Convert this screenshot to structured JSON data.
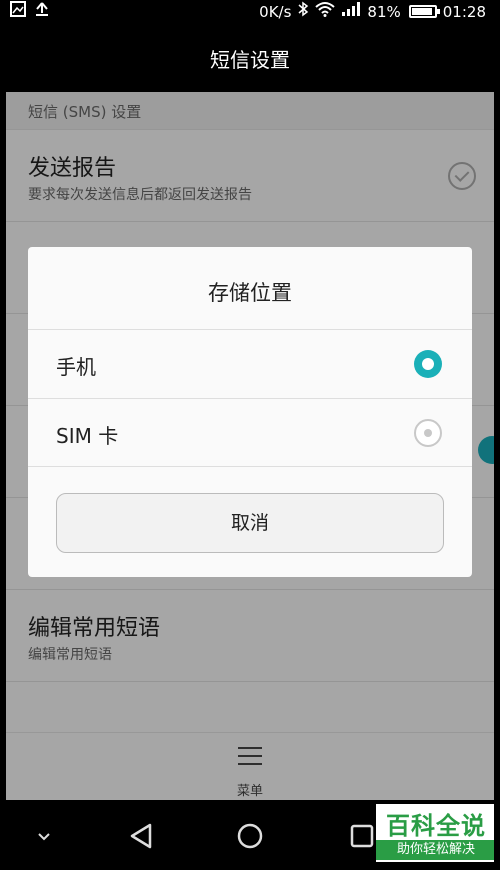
{
  "status_bar": {
    "network_speed": "0K/s",
    "battery_percent": "81%",
    "time": "01:28"
  },
  "header": {
    "title": "短信设置"
  },
  "settings": {
    "section_header": "短信 (SMS) 设置",
    "items": [
      {
        "title": "发送报告",
        "subtitle": "要求每次发送信息后都返回发送报告"
      },
      {
        "title": "编辑常用短语",
        "subtitle": "编辑常用短语"
      }
    ]
  },
  "menu": {
    "label": "菜单"
  },
  "dialog": {
    "title": "存储位置",
    "options": [
      {
        "label": "手机",
        "selected": true
      },
      {
        "label": "SIM 卡",
        "selected": false
      }
    ],
    "cancel_label": "取消"
  },
  "watermark": {
    "brand": "百科全说",
    "tagline": "助你轻松解决"
  },
  "colors": {
    "accent": "#1ab0b8",
    "watermark_green": "#2a9d45"
  }
}
